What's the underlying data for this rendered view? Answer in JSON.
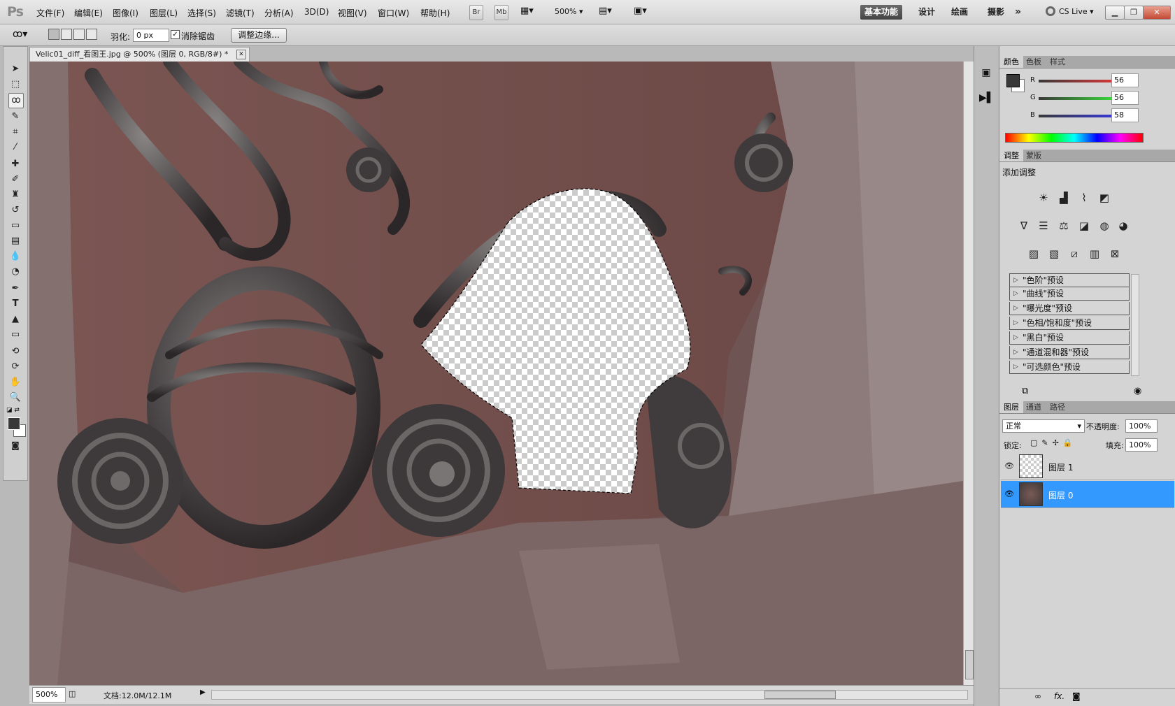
{
  "app": {
    "logo": "Ps"
  },
  "menus": [
    "文件(F)",
    "编辑(E)",
    "图像(I)",
    "图层(L)",
    "选择(S)",
    "滤镜(T)",
    "分析(A)",
    "3D(D)",
    "视图(V)",
    "窗口(W)",
    "帮助(H)"
  ],
  "menubar": {
    "br": "Br",
    "mb": "Mb",
    "zoom": "500%",
    "workspaces": [
      "基本功能",
      "设计",
      "绘画",
      "摄影"
    ],
    "more": "»",
    "cslive": "CS Live"
  },
  "options": {
    "feather_label": "羽化:",
    "feather_value": "0 px",
    "antialias_label": "消除锯齿",
    "antialias_checked": true,
    "refine_edge": "调整边缘..."
  },
  "document": {
    "tab_title": "Velic01_diff_看图王.jpg @ 500% (图层 0, RGB/8#) *",
    "zoom": "500%",
    "doc_size": "文档:12.0M/12.1M"
  },
  "color_panel": {
    "tabs": [
      "颜色",
      "色板",
      "样式"
    ],
    "channels": [
      {
        "name": "R",
        "value": "56"
      },
      {
        "name": "G",
        "value": "56"
      },
      {
        "name": "B",
        "value": "58"
      }
    ]
  },
  "adjust_panel": {
    "tabs": [
      "调整",
      "蒙版"
    ],
    "title": "添加调整",
    "presets": [
      "\"色阶\"预设",
      "\"曲线\"预设",
      "\"曝光度\"预设",
      "\"色相/饱和度\"预设",
      "\"黑白\"预设",
      "\"通道混和器\"预设",
      "\"可选颜色\"预设"
    ]
  },
  "layers_panel": {
    "tabs": [
      "图层",
      "通道",
      "路径"
    ],
    "blend_mode": "正常",
    "opacity_label": "不透明度:",
    "opacity": "100%",
    "lock_label": "锁定:",
    "fill_label": "填充:",
    "fill": "100%",
    "layers": [
      {
        "name": "图层 1",
        "selected": false
      },
      {
        "name": "图层 0",
        "selected": true
      }
    ]
  },
  "colors": {
    "selection": "#3399ff",
    "foreground": "#383838"
  }
}
